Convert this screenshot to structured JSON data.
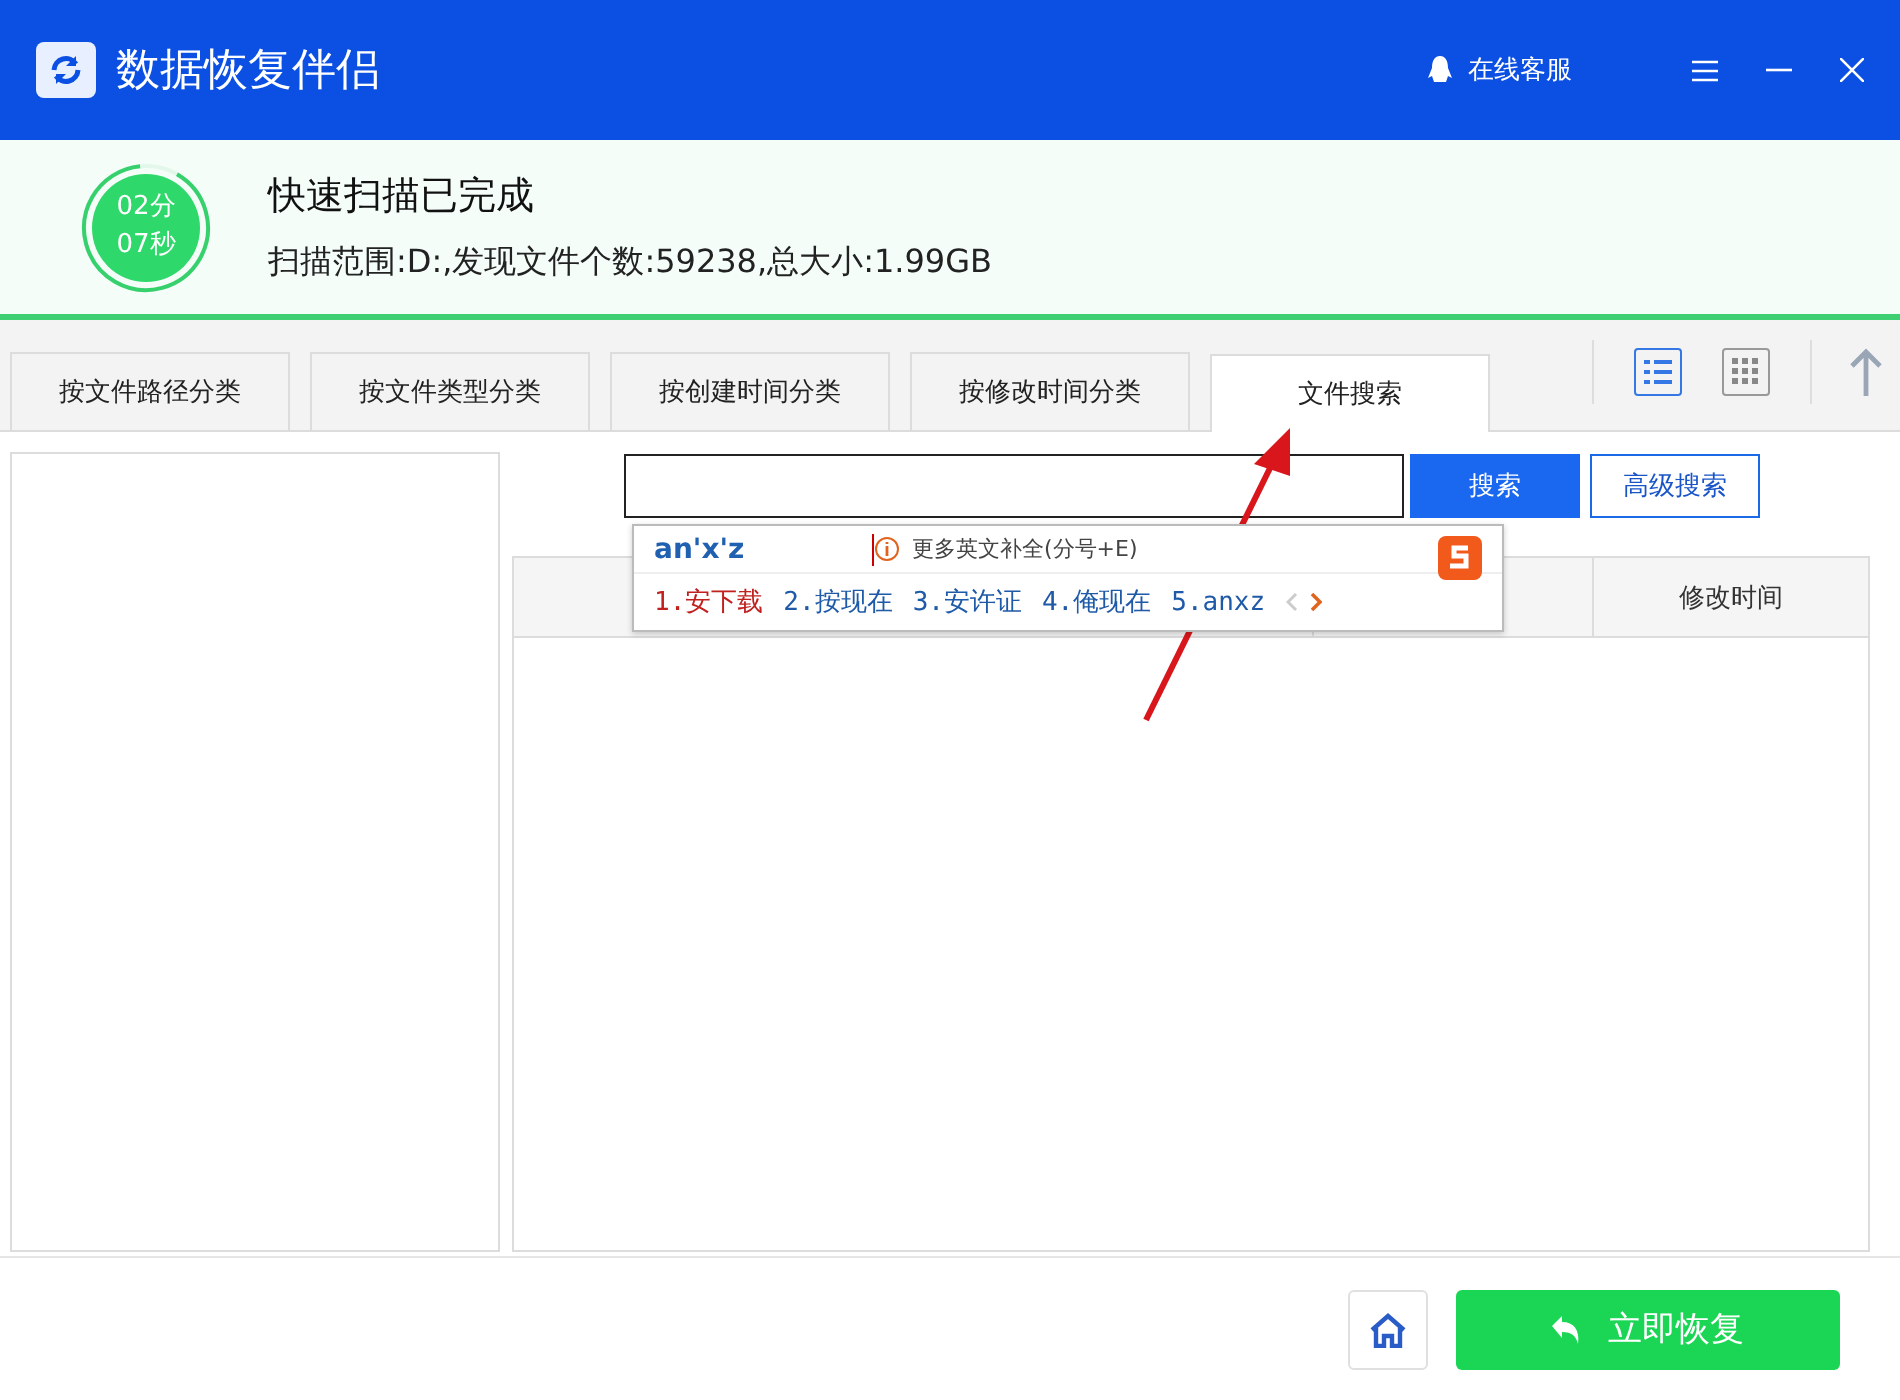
{
  "window": {
    "title": "数据恢复伴侣",
    "service": "在线客服"
  },
  "scan": {
    "minutes": "02分",
    "seconds": "07秒",
    "title": "快速扫描已完成",
    "summary": "扫描范围:D:,发现文件个数:59238,总大小:1.99GB"
  },
  "tabs": [
    {
      "label": "按文件路径分类",
      "selected": false
    },
    {
      "label": "按文件类型分类",
      "selected": false
    },
    {
      "label": "按创建时间分类",
      "selected": false
    },
    {
      "label": "按修改时间分类",
      "selected": false
    },
    {
      "label": "文件搜索",
      "selected": true
    }
  ],
  "view_buttons": [
    {
      "kind": "list",
      "selected": true
    },
    {
      "kind": "grid",
      "selected": false
    }
  ],
  "search": {
    "search_button": "搜索",
    "advanced_button": "高级搜索"
  },
  "ime": {
    "composition": "an'x'z",
    "hint": "更多英文补全(分号+E)",
    "candidates": [
      {
        "label": "1.安下载",
        "selected": true
      },
      {
        "label": "2.按现在",
        "selected": false
      },
      {
        "label": "3.安许证",
        "selected": false
      },
      {
        "label": "4.俺现在",
        "selected": false
      },
      {
        "label": "5.anxz",
        "selected": false
      }
    ]
  },
  "table": {
    "column_3": "修改时间"
  },
  "footer": {
    "restore_button": "立即恢复"
  }
}
